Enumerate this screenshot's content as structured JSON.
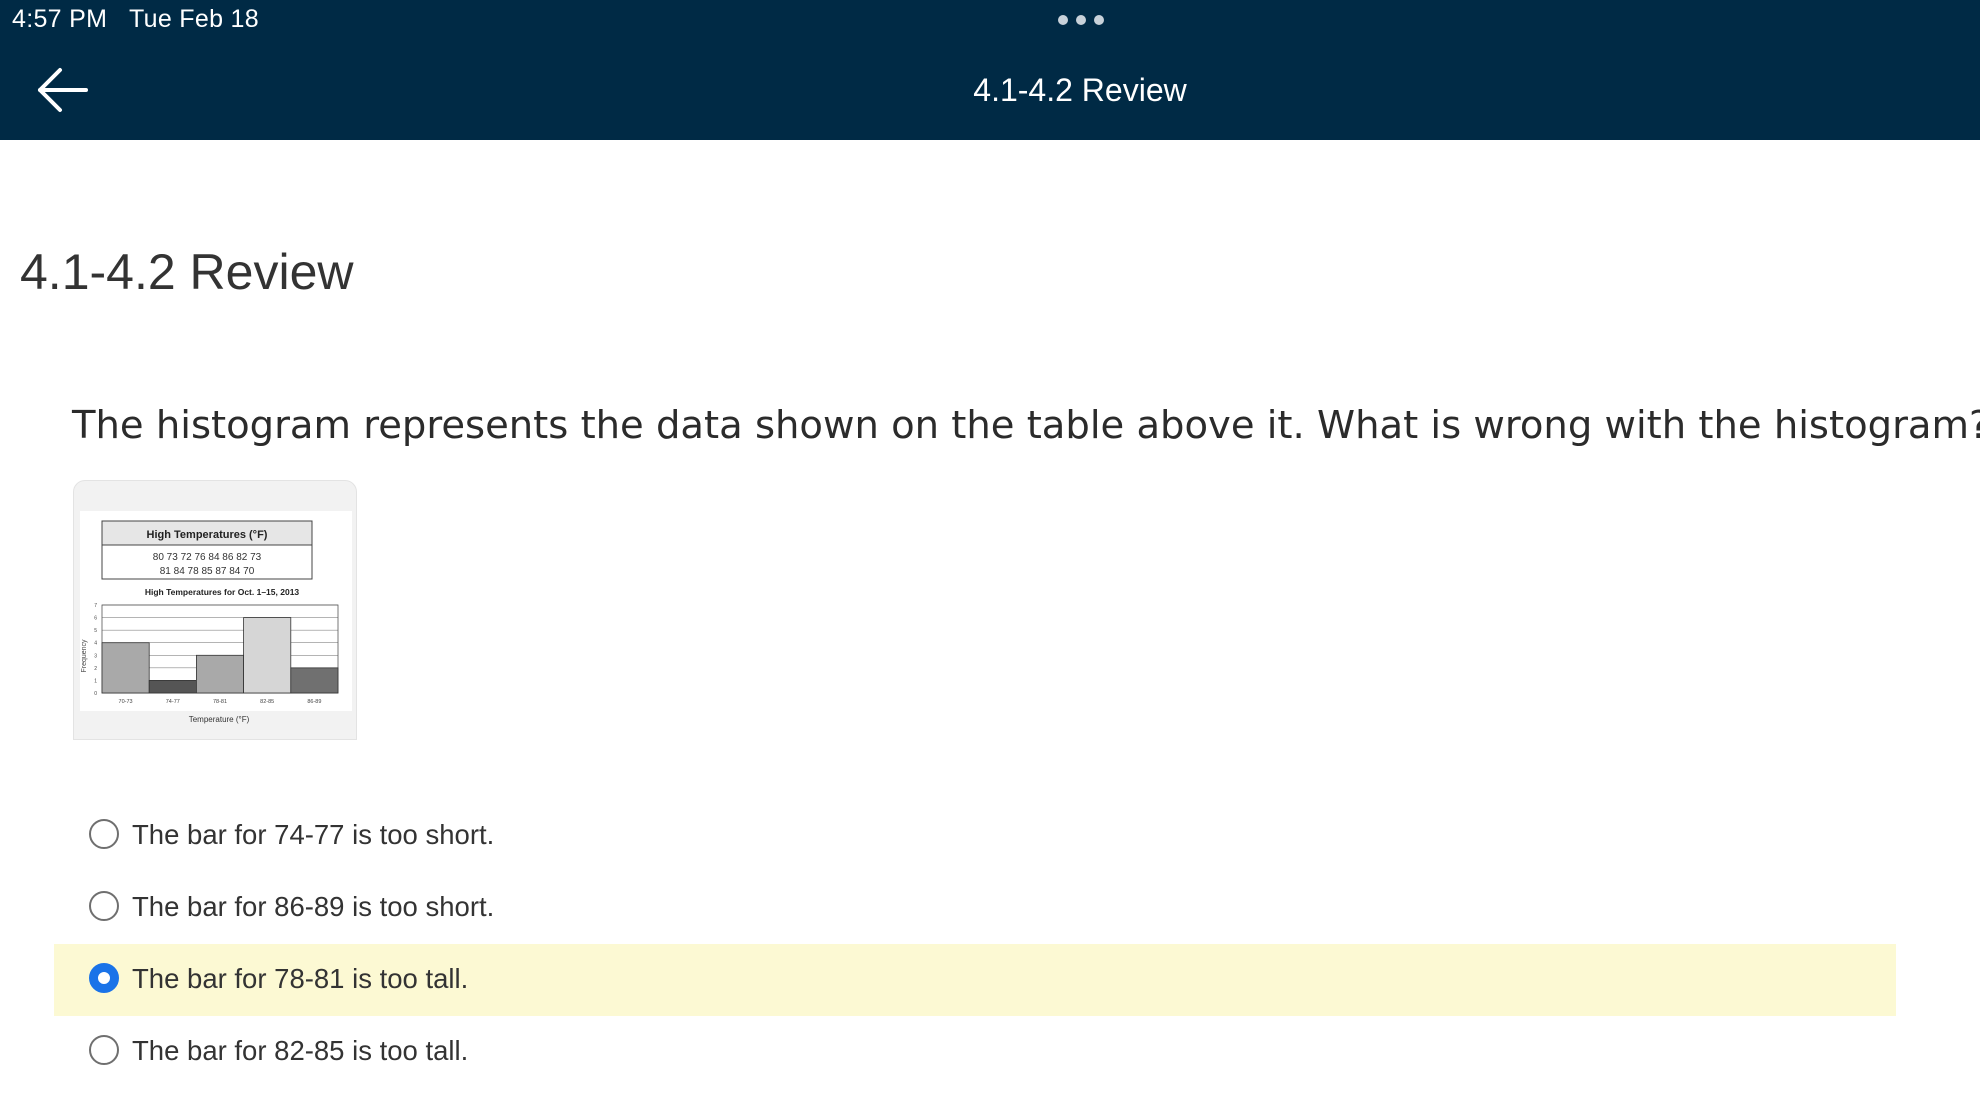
{
  "status_bar": {
    "time": "4:57 PM",
    "date": "Tue Feb 18"
  },
  "nav": {
    "title": "4.1-4.2 Review",
    "back_icon": "arrow-left-icon",
    "more_icon": "more-dots-icon"
  },
  "page": {
    "title": "4.1-4.2 Review"
  },
  "question": {
    "text": "The histogram represents the data shown on the table above it. What is wrong with the histogram?"
  },
  "figure": {
    "table_title": "High Temperatures (°F)",
    "table_row1": "80 73 72 76 84 86 82 73",
    "table_row2": "81 84 78 85 87 84 70",
    "chart_title": "High Temperatures for Oct. 1–15, 2013",
    "ylabel": "Frequency",
    "xlabel": "Temperature (°F)",
    "y_ticks": [
      "0",
      "1",
      "2",
      "3",
      "4",
      "5",
      "6",
      "7"
    ],
    "bar_colors": [
      "#a9a9a9",
      "#555555",
      "#a9a9a9",
      "#d6d6d6",
      "#707070"
    ]
  },
  "chart_data": {
    "type": "bar",
    "title": "High Temperatures for Oct. 1–15, 2013",
    "xlabel": "Temperature (°F)",
    "ylabel": "Frequency",
    "categories": [
      "70-73",
      "74-77",
      "78-81",
      "82-85",
      "86-89"
    ],
    "values": [
      4,
      1,
      3,
      6,
      2
    ],
    "ylim": [
      0,
      7
    ],
    "grid": true
  },
  "options": [
    {
      "label": "The bar for 74-77 is too short.",
      "selected": false
    },
    {
      "label": "The bar for 86-89 is too short.",
      "selected": false
    },
    {
      "label": "The bar for 78-81 is too tall.",
      "selected": true
    },
    {
      "label": "The bar for 82-85 is too tall.",
      "selected": false
    }
  ],
  "colors": {
    "header_bg": "#002a45",
    "selected_bg": "#fcf9d3",
    "radio_checked": "#1a73e8"
  }
}
